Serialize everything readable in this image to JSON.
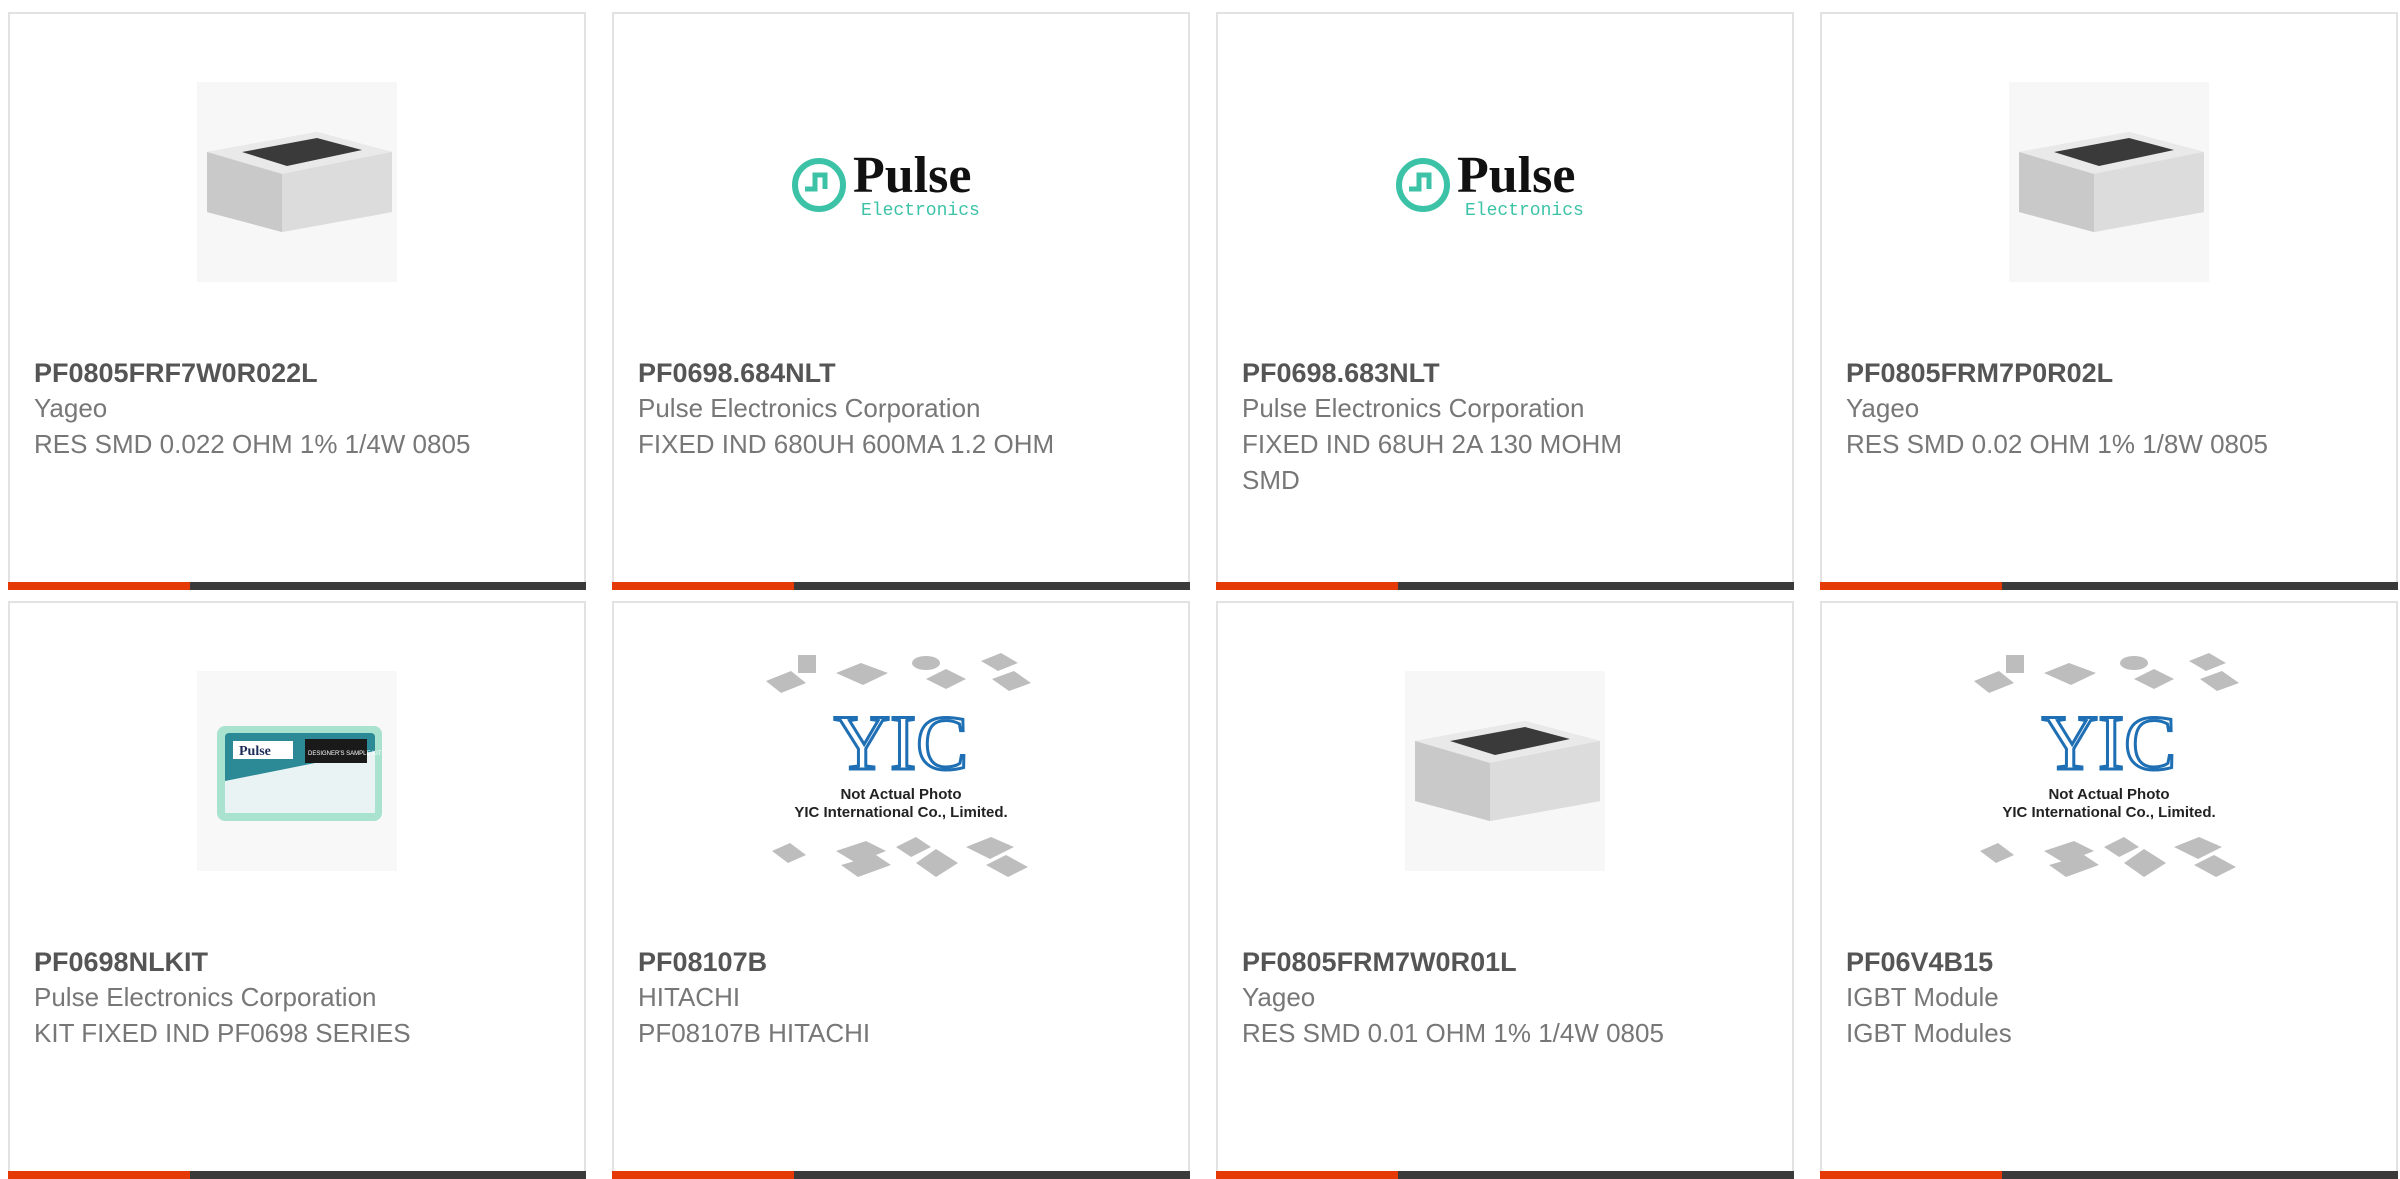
{
  "products": [
    {
      "part": "PF0805FRF7W0R022L",
      "manufacturer": "Yageo",
      "description": "RES SMD 0.022 OHM 1% 1/4W 0805",
      "image": "resistor-chip"
    },
    {
      "part": "PF0698.684NLT",
      "manufacturer": "Pulse Electronics Corporation",
      "description": "FIXED IND 680UH 600MA 1.2 OHM",
      "image": "pulse-logo"
    },
    {
      "part": "PF0698.683NLT",
      "manufacturer": "Pulse Electronics Corporation",
      "description": "FIXED IND 68UH 2A 130 MOHM SMD",
      "image": "pulse-logo"
    },
    {
      "part": "PF0805FRM7P0R02L",
      "manufacturer": "Yageo",
      "description": "RES SMD 0.02 OHM 1% 1/8W 0805",
      "image": "resistor-chip"
    },
    {
      "part": "PF0698NLKIT",
      "manufacturer": "Pulse Electronics Corporation",
      "description": "KIT FIXED IND PF0698 SERIES",
      "image": "pulse-kit-box"
    },
    {
      "part": "PF08107B",
      "manufacturer": "HITACHI",
      "description": "PF08107B HITACHI",
      "image": "yic-placeholder"
    },
    {
      "part": "PF0805FRM7W0R01L",
      "manufacturer": "Yageo",
      "description": "RES SMD 0.01 OHM 1% 1/4W 0805",
      "image": "resistor-chip"
    },
    {
      "part": "PF06V4B15",
      "manufacturer": "IGBT Module",
      "description": "IGBT Modules",
      "image": "yic-placeholder"
    }
  ],
  "logos": {
    "pulse_name": "Pulse",
    "pulse_sub": "Electronics",
    "kit_brand": "Pulse",
    "kit_label": "DESIGNER'S SAMPLE KIT",
    "yic_mark": "YIC",
    "yic_line1": "Not Actual Photo",
    "yic_line2": "YIC International Co., Limited."
  },
  "colors": {
    "accent": "#e63a06",
    "bar": "#3a3a3a",
    "pulse_teal": "#3cc3a7",
    "yic_blue": "#1f6fb5"
  }
}
